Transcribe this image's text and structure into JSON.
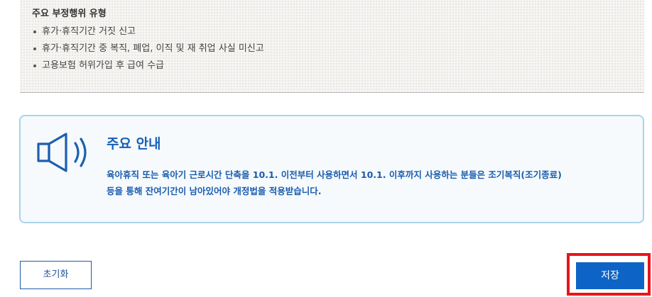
{
  "fraud": {
    "title": "주요 부정행위 유형",
    "items": [
      "휴가·휴직기간 거짓 신고",
      "휴가·휴직기간 중 복직, 폐업, 이직 및 재 취업 사실 미신고",
      "고용보험 허위가입 후 급여 수급"
    ]
  },
  "notice": {
    "icon": "speaker-icon",
    "title": "주요 안내",
    "line1": "육아휴직 또는 육아기 근로시간 단축을 10.1. 이전부터 사용하면서 10.1. 이후까지 사용하는 분들은 조기복직(조기종료)",
    "line2": "등을 통해 잔여기간이 남아있어야 개정법을 적용받습니다.",
    "colors": {
      "border": "#a9d3ea",
      "text": "#1a5cad",
      "title": "#1560b5"
    }
  },
  "buttons": {
    "reset_label": "초기화",
    "save_label": "저장",
    "save_color": "#0d64c6",
    "highlight_color": "#e8141c"
  }
}
